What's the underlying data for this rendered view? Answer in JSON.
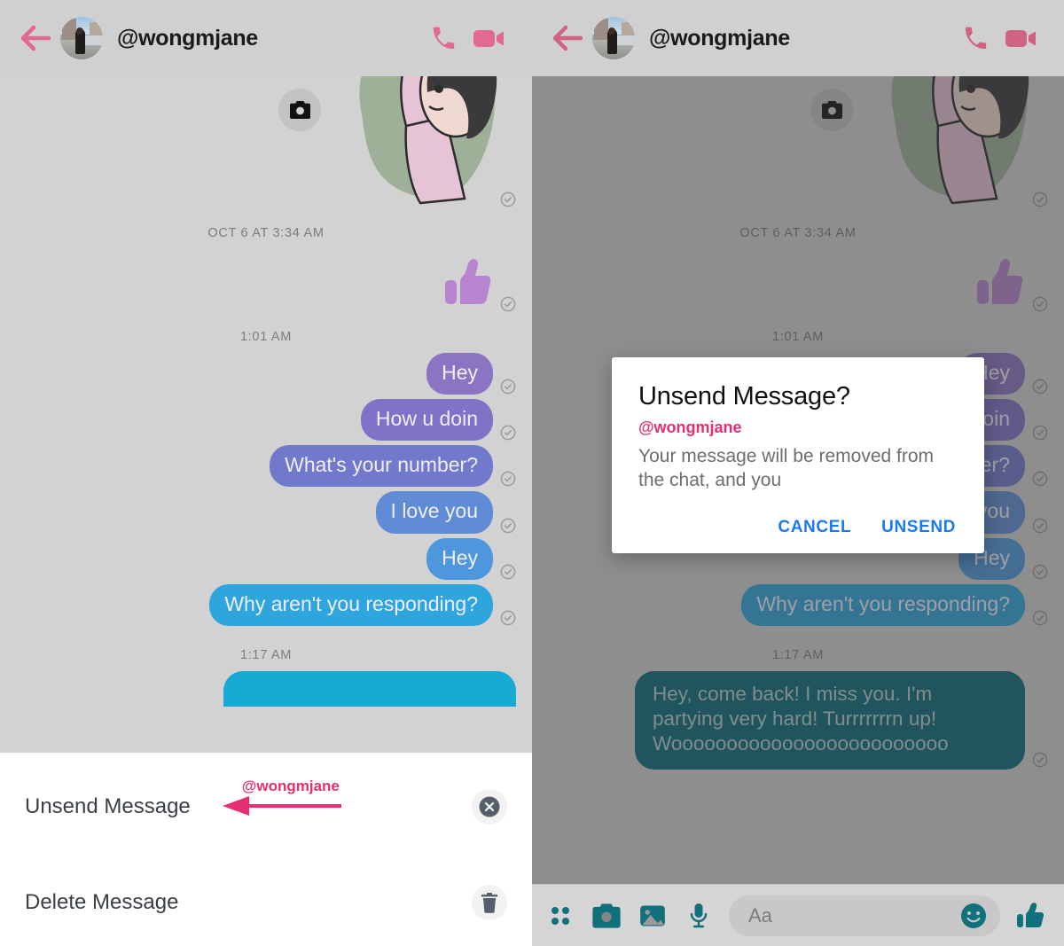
{
  "header": {
    "back_icon": "back-arrow-icon",
    "avatar": "user-avatar",
    "handle": "@wongmjane",
    "call_icon": "phone-icon",
    "video_icon": "video-camera-icon",
    "accent": "#e2698f",
    "background": "#d0d0d0"
  },
  "thread": {
    "camera_badge_icon": "camera-icon",
    "sticker": "sticker-girl-peace-sign",
    "separators": {
      "oct6": "OCT 6 AT 3:34 AM",
      "one_oh_one": "1:01 AM",
      "one_seventeen": "1:17 AM"
    },
    "thumbs_up_reaction": "thumbs-up-sticker",
    "messages": [
      {
        "text": "Hey",
        "color": "#8a74c3"
      },
      {
        "text": "How u doin",
        "color": "#7f73c8"
      },
      {
        "text": "What's your number?",
        "color": "#7179cc"
      },
      {
        "text": "I love you",
        "color": "#5f8cd4"
      },
      {
        "text": "Hey",
        "color": "#4e97dd"
      },
      {
        "text": "Why aren't you responding?",
        "color": "#2fa5dd"
      }
    ],
    "long_message": "Hey, come back! I miss you. I'm partying very hard! Turrrrrrrn up! Wooooooooooooooooooooooooo",
    "long_message_color": "#0b6b78",
    "delivery_icon": "delivered-check-icon"
  },
  "sheet": {
    "items": [
      {
        "label": "Unsend Message",
        "icon": "close-circle-icon"
      },
      {
        "label": "Delete Message",
        "icon": "trash-icon"
      }
    ],
    "annotation": {
      "label": "@wongmjane",
      "color": "#e52f72",
      "icon": "annotation-arrow-icon"
    }
  },
  "dialog": {
    "title": "Unsend Message?",
    "watermark": "@wongmjane",
    "body": "Your message will be removed from the chat, and you",
    "cancel_label": "CANCEL",
    "confirm_label": "UNSEND",
    "button_color": "#1a7bf0"
  },
  "composer": {
    "icons": [
      "apps-grid-icon",
      "camera-icon",
      "photo-icon",
      "microphone-icon"
    ],
    "placeholder": "Aa",
    "emoji_icon": "smiley-icon",
    "like_icon": "thumbs-up-icon",
    "accent": "#10707c"
  }
}
